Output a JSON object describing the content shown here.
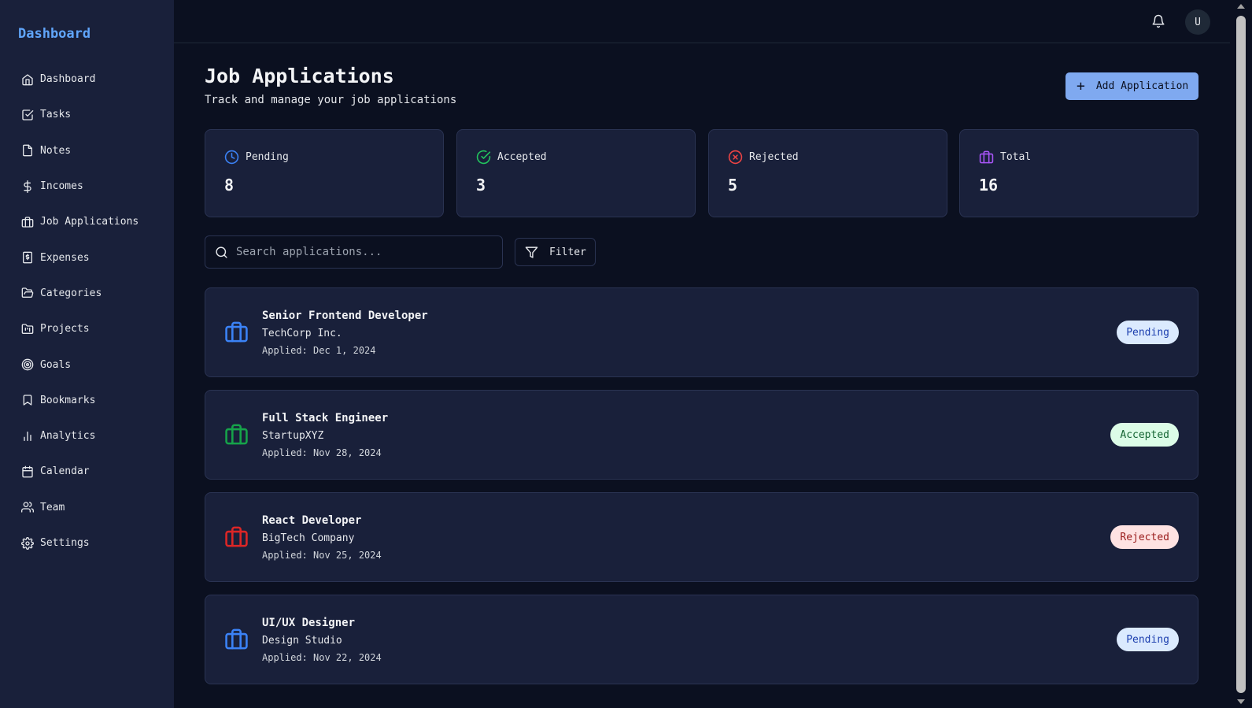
{
  "brand": "Dashboard",
  "sidebar": {
    "items": [
      {
        "label": "Dashboard",
        "icon": "home-icon"
      },
      {
        "label": "Tasks",
        "icon": "check-square-icon"
      },
      {
        "label": "Notes",
        "icon": "file-icon"
      },
      {
        "label": "Incomes",
        "icon": "dollar-icon"
      },
      {
        "label": "Job Applications",
        "icon": "briefcase-icon"
      },
      {
        "label": "Expenses",
        "icon": "receipt-icon"
      },
      {
        "label": "Categories",
        "icon": "folder-open-icon"
      },
      {
        "label": "Projects",
        "icon": "folder-kanban-icon"
      },
      {
        "label": "Goals",
        "icon": "target-icon"
      },
      {
        "label": "Bookmarks",
        "icon": "bookmark-icon"
      },
      {
        "label": "Analytics",
        "icon": "bar-chart-icon"
      },
      {
        "label": "Calendar",
        "icon": "calendar-icon"
      },
      {
        "label": "Team",
        "icon": "users-icon"
      },
      {
        "label": "Settings",
        "icon": "gear-icon"
      }
    ]
  },
  "topbar": {
    "avatar_initial": "U"
  },
  "header": {
    "title": "Job Applications",
    "subtitle": "Track and manage your job applications",
    "add_label": "Add Application"
  },
  "stats": [
    {
      "label": "Pending",
      "value": "8",
      "color": "#3b82f6"
    },
    {
      "label": "Accepted",
      "value": "3",
      "color": "#22c55e"
    },
    {
      "label": "Rejected",
      "value": "5",
      "color": "#ef4444"
    },
    {
      "label": "Total",
      "value": "16",
      "color": "#a855f7"
    }
  ],
  "search": {
    "placeholder": "Search applications..."
  },
  "filter_label": "Filter",
  "applications": [
    {
      "title": "Senior Frontend Developer",
      "company": "TechCorp Inc.",
      "date": "Applied: Dec 1, 2024",
      "status": "Pending",
      "color": "#3b82f6"
    },
    {
      "title": "Full Stack Engineer",
      "company": "StartupXYZ",
      "date": "Applied: Nov 28, 2024",
      "status": "Accepted",
      "color": "#16a34a"
    },
    {
      "title": "React Developer",
      "company": "BigTech Company",
      "date": "Applied: Nov 25, 2024",
      "status": "Rejected",
      "color": "#dc2626"
    },
    {
      "title": "UI/UX Designer",
      "company": "Design Studio",
      "date": "Applied: Nov 22, 2024",
      "status": "Pending",
      "color": "#3b82f6"
    }
  ]
}
